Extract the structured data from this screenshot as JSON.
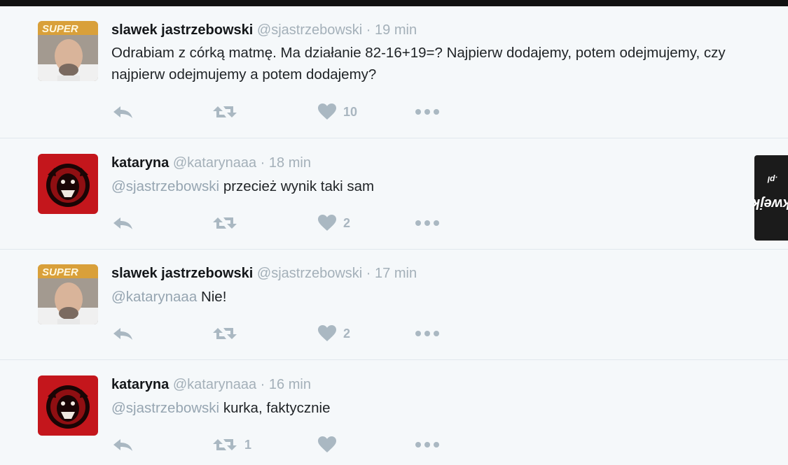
{
  "tweets": [
    {
      "name": "slawek jastrzebowski",
      "handle": "@sjastrzebowski",
      "dot": "·",
      "time": "19 min",
      "mention": "",
      "text": "Odrabiam z córką matmę. Ma działanie 82-16+19=? Najpierw dodajemy, potem odejmujemy, czy najpierw odejmujemy a potem dodajemy?",
      "retweets": "",
      "likes": "10",
      "avatar": "bald-man-avatar"
    },
    {
      "name": "kataryna",
      "handle": "@katarynaaa",
      "dot": "·",
      "time": "18 min",
      "mention": "@sjastrzebowski",
      "text": "przecież wynik taki sam",
      "retweets": "",
      "likes": "2",
      "avatar": "red-bear-avatar"
    },
    {
      "name": "slawek jastrzebowski",
      "handle": "@sjastrzebowski",
      "dot": "·",
      "time": "17 min",
      "mention": "@katarynaaa",
      "text": "Nie!",
      "retweets": "",
      "likes": "2",
      "avatar": "bald-man-avatar"
    },
    {
      "name": "kataryna",
      "handle": "@katarynaaa",
      "dot": "·",
      "time": "16 min",
      "mention": "@sjastrzebowski",
      "text": "kurka, faktycznie",
      "retweets": "1",
      "likes": "",
      "avatar": "red-bear-avatar"
    }
  ],
  "watermark": {
    "brand": "kwejk",
    "tld": ".pl"
  },
  "icons": {
    "reply": "reply-icon",
    "retweet": "retweet-icon",
    "like": "heart-icon",
    "more": "more-icon"
  },
  "colors": {
    "background": "#f5f8fa",
    "icon": "#aab8c2",
    "name": "#14171a",
    "muted": "#a4b0b9",
    "bear_red": "#c4161c"
  }
}
